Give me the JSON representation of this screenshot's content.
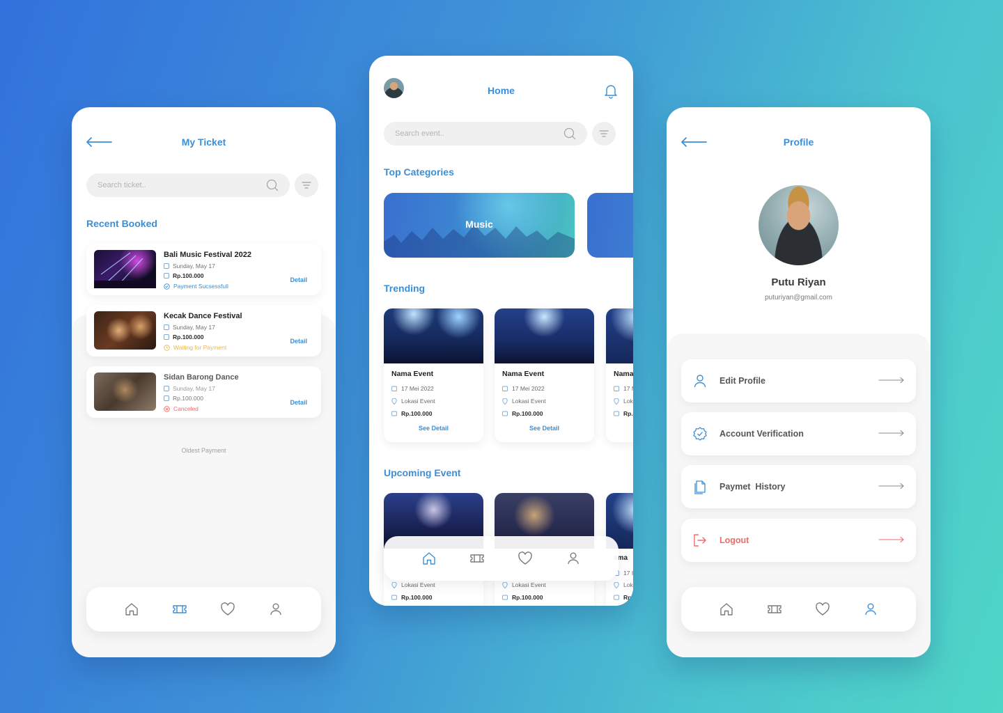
{
  "ticket_screen": {
    "title": "My Ticket",
    "search_placeholder": "Search ticket..",
    "section_title": "Recent Booked",
    "tickets": [
      {
        "name": "Bali Music Festival 2022",
        "date": "Sunday, May 17",
        "price": "Rp.100.000",
        "status": "Payment Sucsessfull",
        "status_color": "#3b8ed8",
        "detail": "Detail"
      },
      {
        "name": "Kecak Dance Festival",
        "date": "Sunday, May 17",
        "price": "Rp.100.000",
        "status": "Waiting for Payment",
        "status_color": "#f0b64a",
        "detail": "Detail"
      },
      {
        "name": "Sidan Barong Dance",
        "date": "Sunday, May 17",
        "price": "Rp.100.000",
        "status": "Canceled",
        "status_color": "#ef6b6b",
        "detail": "Detail"
      }
    ],
    "oldest_label": "Oldest Payment",
    "nav_active": "ticket"
  },
  "home_screen": {
    "title": "Home",
    "search_placeholder": "Search event..",
    "categories_title": "Top Categories",
    "categories": [
      "Music"
    ],
    "trending_title": "Trending",
    "trending": [
      {
        "name": "Nama Event",
        "date": "17 Mei 2022",
        "location": "Lokasi Event",
        "price": "Rp.100.000",
        "link": "See Detail"
      },
      {
        "name": "Nama Event",
        "date": "17 Mei 2022",
        "location": "Lokasi Event",
        "price": "Rp.100.000",
        "link": "See Detail"
      },
      {
        "name": "Nama",
        "date": "17 M",
        "location": "Lok",
        "price": "Rp."
      }
    ],
    "upcoming_title": "Upcoming Event",
    "upcoming": [
      {
        "location": "Lokasi Event",
        "price": "Rp.100.000"
      },
      {
        "location": "Lokasi Event",
        "price": "Rp.100.000"
      },
      {
        "name": "ama",
        "date": "17 I",
        "location": "Lok",
        "price": "Rp."
      }
    ],
    "nav_active": "home"
  },
  "profile_screen": {
    "title": "Profile",
    "name": "Putu Riyan",
    "email": "puturiyan@gmail.com",
    "menu": [
      {
        "label": "Edit Profile",
        "icon": "user-icon"
      },
      {
        "label": "Account Verification",
        "icon": "verified-badge-icon"
      },
      {
        "label": "Paymet  History",
        "icon": "document-icon"
      },
      {
        "label": "Logout",
        "icon": "logout-icon"
      }
    ],
    "nav_active": "profile"
  },
  "colors": {
    "accent": "#3b8ed8",
    "danger": "#ef6b6b",
    "warning": "#f0b64a"
  }
}
